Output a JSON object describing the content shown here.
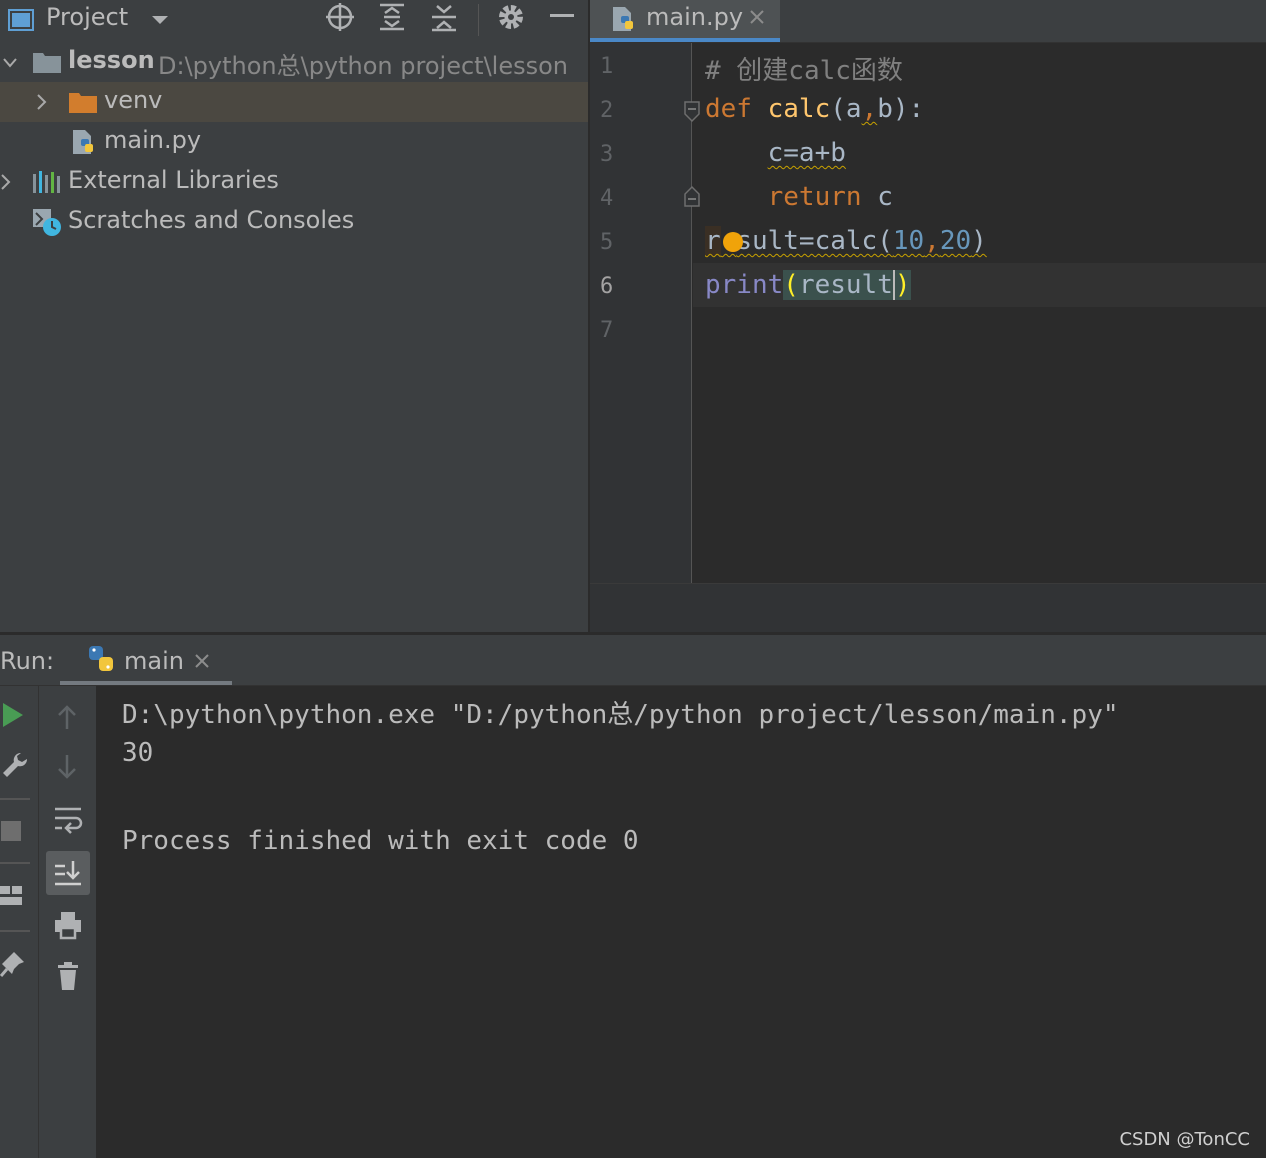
{
  "project_panel": {
    "title": "Project",
    "tree": [
      {
        "label": "lesson",
        "path": "D:\\python总\\python project\\lesson"
      },
      {
        "label": "venv"
      },
      {
        "label": "main.py"
      },
      {
        "label": "External Libraries"
      },
      {
        "label": "Scratches and Consoles"
      }
    ]
  },
  "editor": {
    "tab_label": "main.py",
    "line_numbers": [
      "1",
      "2",
      "3",
      "4",
      "5",
      "6",
      "7"
    ],
    "lines": {
      "l1": "# 创建calc函数",
      "l2_kw": "def",
      "l2_fn": "calc",
      "l2_open": "(",
      "l2_a": "a",
      "l2_comma": ",",
      "l2_rest": "b):",
      "l3": "c=a+b",
      "l4_kw": "return",
      "l4_var": " c",
      "l5_r": "r",
      "l5_rest": "sult=calc(",
      "l5_n1": "10",
      "l5_comma": ",",
      "l5_n2": "20",
      "l5_close": ")",
      "l6_fn": "print",
      "l6_open": "(",
      "l6_arg": "result",
      "l6_close": ")"
    }
  },
  "run_panel": {
    "label": "Run:",
    "tab_label": "main",
    "output": [
      "D:\\python\\python.exe \"D:/python总/python project/lesson/main.py\"",
      "30",
      "",
      "Process finished with exit code 0"
    ]
  },
  "watermark": "CSDN @TonCC",
  "colors": {
    "keyword": "#cc7832",
    "function": "#ffc66d",
    "number": "#6897bb",
    "builtin": "#8888c6",
    "comment": "#808080",
    "run_green": "#499c54",
    "accent_blue": "#4a88c7"
  }
}
